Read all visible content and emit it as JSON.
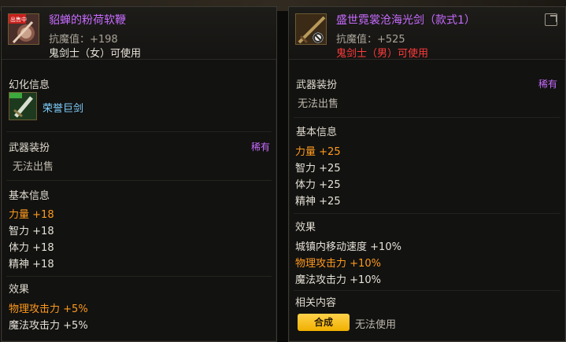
{
  "left": {
    "item_name": "貂蝉的粉荷软鞭",
    "badge": "出售中",
    "resist": "抗魔值：+198",
    "usable": "鬼剑士（女）可使用",
    "transform_title": "幻化信息",
    "transform_item": "荣誉巨剑",
    "weapon_skin_title": "武器装扮",
    "rarity": "稀有",
    "cannot_sell": "无法出售",
    "basic_title": "基本信息",
    "stats": [
      {
        "label": "力量",
        "value": "+18"
      },
      {
        "label": "智力",
        "value": "+18"
      },
      {
        "label": "体力",
        "value": "+18"
      },
      {
        "label": "精神",
        "value": "+18"
      }
    ],
    "effect_title": "效果",
    "effects": [
      {
        "label": "物理攻击力",
        "value": "+5%"
      },
      {
        "label": "魔法攻击力",
        "value": "+5%"
      }
    ]
  },
  "right": {
    "item_name": "盛世霓裳沧海光剑（款式1）",
    "resist": "抗魔值：+525",
    "usable": "鬼剑士（男）可使用",
    "weapon_skin_title": "武器装扮",
    "rarity": "稀有",
    "cannot_sell": "无法出售",
    "basic_title": "基本信息",
    "stats": [
      {
        "label": "力量",
        "value": "+25"
      },
      {
        "label": "智力",
        "value": "+25"
      },
      {
        "label": "体力",
        "value": "+25"
      },
      {
        "label": "精神",
        "value": "+25"
      }
    ],
    "effect_title": "效果",
    "effects": [
      {
        "label": "城镇内移动速度",
        "value": "+10%"
      },
      {
        "label": "物理攻击力",
        "value": "+10%"
      },
      {
        "label": "魔法攻击力",
        "value": "+10%"
      }
    ],
    "related_title": "相关内容",
    "craft_button": "合成",
    "unusable": "无法使用"
  },
  "colors": {
    "item_name": "#c86bff",
    "highlight": "#ff9a1e",
    "warning": "#ff3b3b",
    "button": "#f0b000"
  },
  "icons": [
    "whip-item-icon",
    "greatsword-item-icon",
    "lightsword-item-icon",
    "prohibited-icon",
    "external-link-icon"
  ]
}
